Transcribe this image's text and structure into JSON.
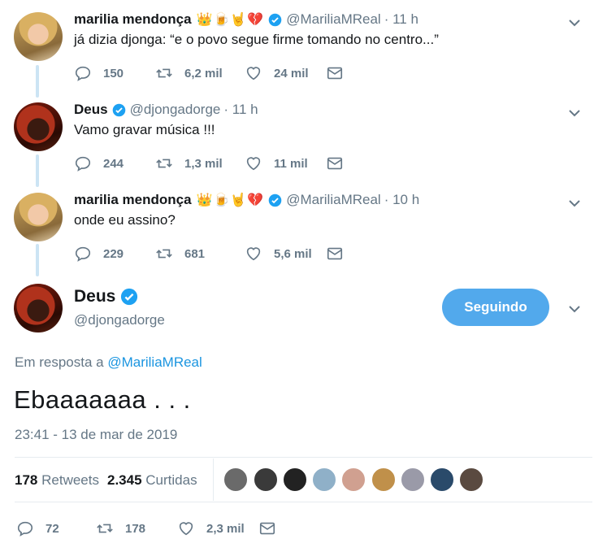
{
  "tweets": [
    {
      "name": "marilia mendonça",
      "emojis": "👑🍺🤘💔",
      "handle": "@MariliaMReal",
      "time": "· 11 h",
      "text": "já dizia djonga: “e o povo segue firme tomando no centro...”",
      "replies": "150",
      "retweets": "6,2 mil",
      "likes": "24 mil"
    },
    {
      "name": "Deus",
      "emojis": "",
      "handle": "@djongadorge",
      "time": "· 11 h",
      "text": "Vamo gravar música !!!",
      "replies": "244",
      "retweets": "1,3 mil",
      "likes": "11 mil"
    },
    {
      "name": "marilia mendonça",
      "emojis": "👑🍺🤘💔",
      "handle": "@MariliaMReal",
      "time": "· 10 h",
      "text": "onde eu assino?",
      "replies": "229",
      "retweets": "681",
      "likes": "5,6 mil"
    }
  ],
  "main": {
    "name": "Deus",
    "handle": "@djongadorge",
    "follow_label": "Seguindo",
    "reply_prefix": "Em resposta a",
    "reply_handle": "@MariliaMReal",
    "text": "Ebaaaaaaa . . .",
    "datetime": "23:41 - 13 de mar de 2019",
    "retweet_count": "178",
    "retweet_label": "Retweets",
    "like_count": "2.345",
    "like_label": "Curtidas",
    "replies": "72",
    "retweets": "178",
    "likes": "2,3 mil"
  },
  "colors": {
    "accent": "#1da1f2",
    "follow_button": "#52a9ec",
    "muted": "#657786",
    "thread_line": "#cce4f4"
  }
}
